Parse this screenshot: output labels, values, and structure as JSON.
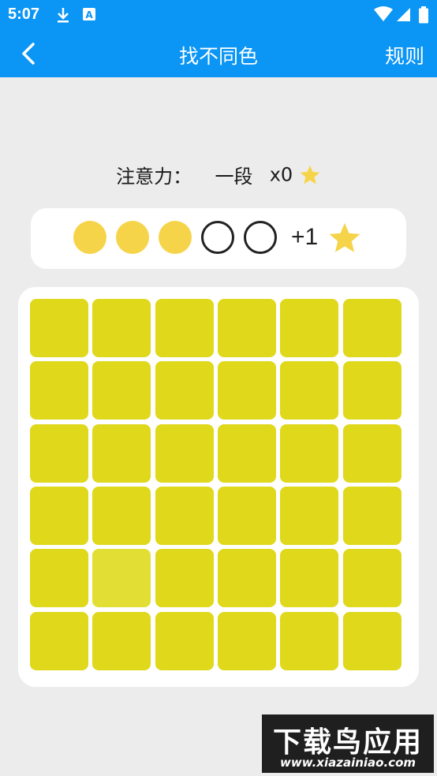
{
  "status_bar": {
    "time": "5:07",
    "icons": [
      "download-icon",
      "a-app-icon",
      "wifi-icon",
      "signal-icon",
      "battery-icon"
    ]
  },
  "app_bar": {
    "title": "找不同色",
    "rules_label": "规则",
    "back_icon": "chevron-left-icon"
  },
  "level": {
    "label": "注意力：",
    "rank": "一段",
    "multiplier": "x0"
  },
  "progress": {
    "filled_count": 3,
    "total": 5,
    "reward": "+1"
  },
  "board": {
    "rows": 6,
    "cols": 6,
    "odd_tile": {
      "row": 5,
      "col": 2
    }
  },
  "colors": {
    "primary": "#0b95f5",
    "tile": "#dfd81b",
    "tile_odd": "#e3de33",
    "star": "#f6d44a"
  },
  "watermark": {
    "title": "下载鸟应用",
    "url": "www.xiazainiao.com"
  }
}
